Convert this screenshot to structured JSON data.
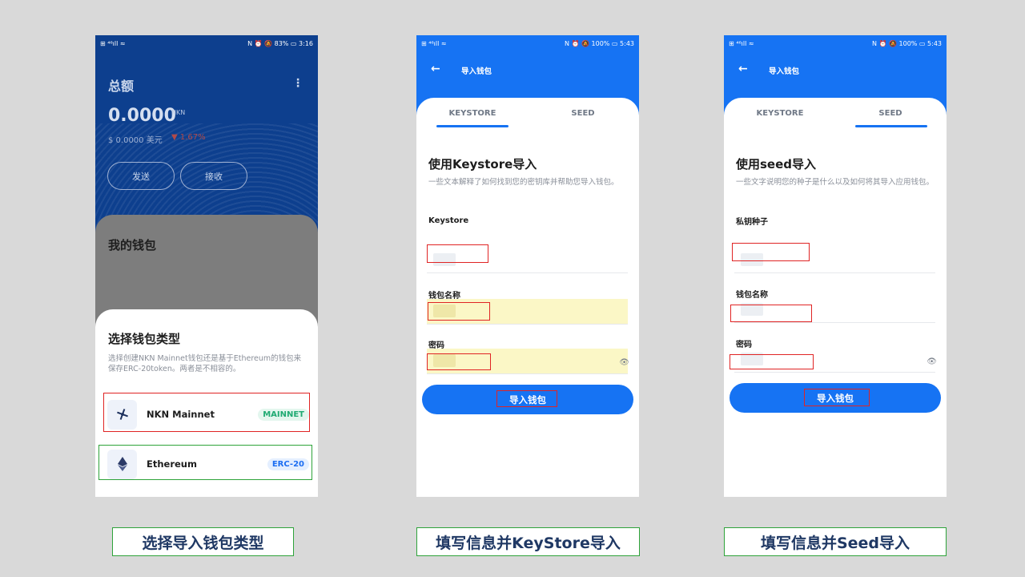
{
  "colors": {
    "brand_blue": "#1673f3",
    "dark_blue": "#0d3f8e",
    "highlight_red": "#e02424",
    "highlight_green": "#2ea33a",
    "mainnet_green": "#1faa72",
    "caption_text": "#1f3864"
  },
  "phone1": {
    "status": {
      "left": "⊞ ⁴⁶ıll ≈",
      "right": "N ⏰ 🔕 83% ▭ 3:16"
    },
    "total_title": "总额",
    "menu_icon": "⋮",
    "balance": "0.0000",
    "unit": "NKN",
    "fiat": "$ 0.0000 美元",
    "change": "▼ 1.67%",
    "send_label": "发送",
    "receive_label": "接收",
    "my_wallet_title": "我的钱包",
    "modal": {
      "title": "选择钱包类型",
      "description": "选择创建NKN Mainnet钱包还是基于Ethereum的钱包来保存ERC-20token。两者是不相容的。",
      "options": [
        {
          "icon": "nkn-logo-icon",
          "label": "NKN Mainnet",
          "badge": "MAINNET"
        },
        {
          "icon": "ethereum-logo-icon",
          "label": "Ethereum",
          "badge": "ERC-20"
        }
      ]
    }
  },
  "phone2": {
    "status": {
      "left": "⊞ ⁴⁶ıll ≈",
      "right": "N ⏰ 🔕 100% ▭ 5:43"
    },
    "header_title": "导入钱包",
    "tabs": [
      "KEYSTORE",
      "SEED"
    ],
    "active_tab": "KEYSTORE",
    "form_title": "使用Keystore导入",
    "form_desc": "一些文本解释了如何找到您的密钥库并帮助您导入钱包。",
    "fields": [
      {
        "label": "Keystore"
      },
      {
        "label": "钱包名称"
      },
      {
        "label": "密码"
      }
    ],
    "button_label": "导入钱包"
  },
  "phone3": {
    "status": {
      "left": "⊞ ⁴⁶ıll ≈",
      "right": "N ⏰ 🔕 100% ▭ 5:43"
    },
    "header_title": "导入钱包",
    "tabs": [
      "KEYSTORE",
      "SEED"
    ],
    "active_tab": "SEED",
    "form_title": "使用seed导入",
    "form_desc": "一些文字说明您的种子是什么以及如何将其导入应用钱包。",
    "fields": [
      {
        "label": "私钥种子"
      },
      {
        "label": "钱包名称"
      },
      {
        "label": "密码"
      }
    ],
    "button_label": "导入钱包"
  },
  "captions": [
    "选择导入钱包类型",
    "填写信息并KeyStore导入",
    "填写信息并Seed导入"
  ]
}
